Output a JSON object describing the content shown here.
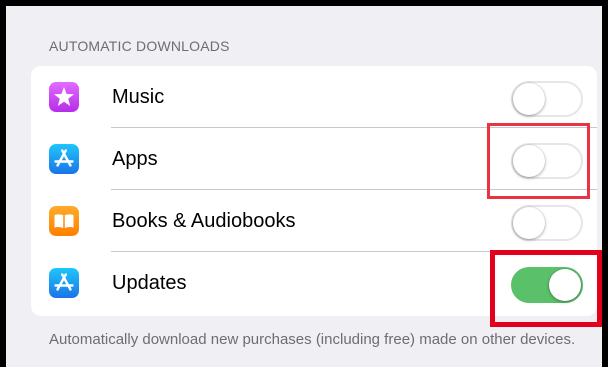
{
  "section": {
    "header": "AUTOMATIC DOWNLOADS",
    "footer": "Automatically download new purchases (including free) made on other devices."
  },
  "rows": [
    {
      "label": "Music",
      "icon": "star-icon",
      "icon_color": "#c644fc",
      "toggle_on": false
    },
    {
      "label": "Apps",
      "icon": "app-store-icon",
      "icon_color": "#1e8cf0",
      "toggle_on": false
    },
    {
      "label": "Books & Audiobooks",
      "icon": "book-icon",
      "icon_color": "#ff9500",
      "toggle_on": false
    },
    {
      "label": "Updates",
      "icon": "app-store-icon",
      "icon_color": "#1e8cf0",
      "toggle_on": true
    }
  ],
  "colors": {
    "toggle_on": "#5ac06a",
    "annotation_red": "#e4001b"
  }
}
